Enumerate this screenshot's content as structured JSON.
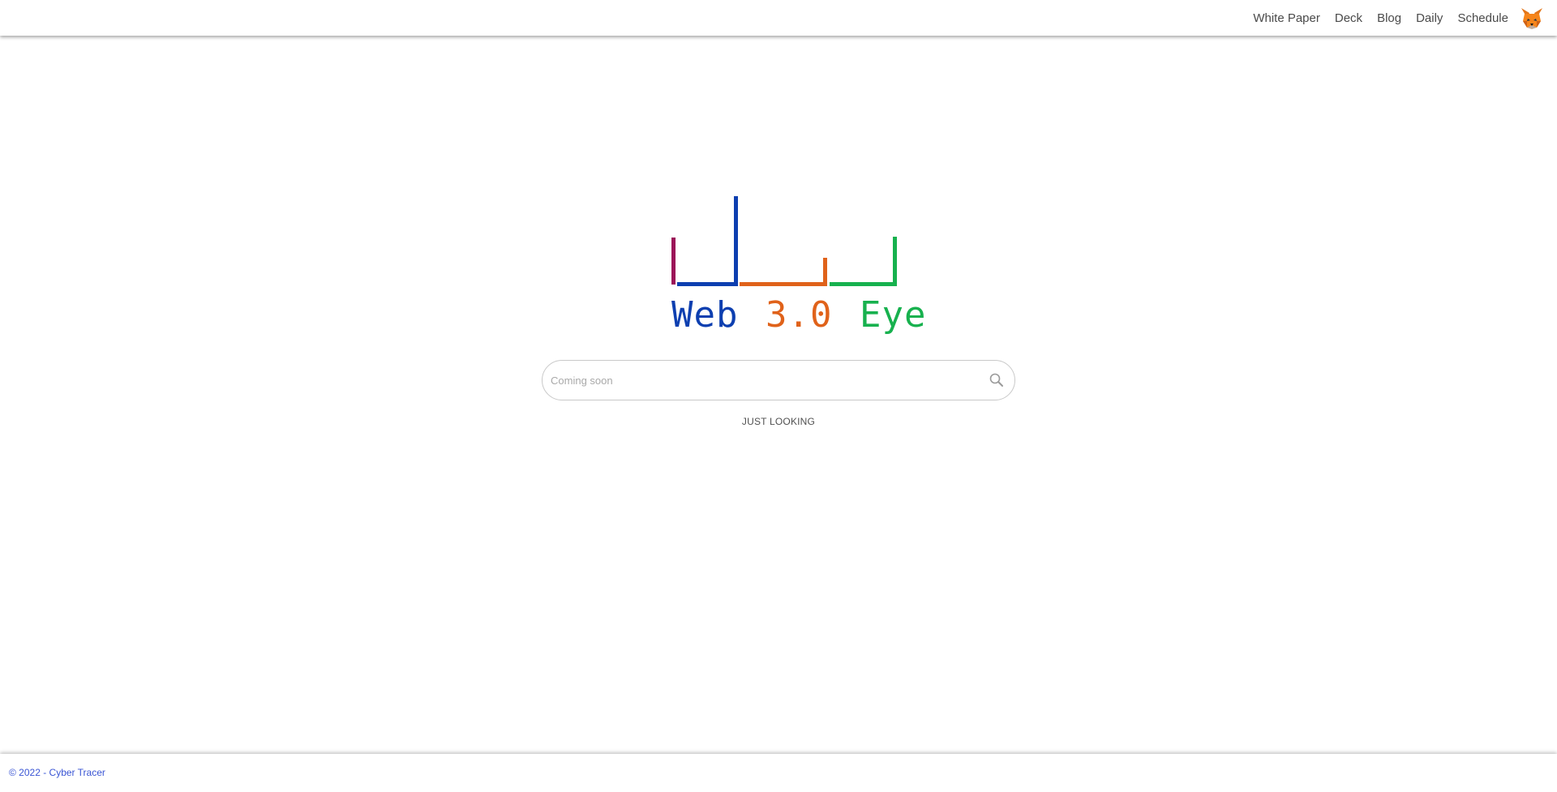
{
  "nav": {
    "items": [
      {
        "label": "White Paper"
      },
      {
        "label": "Deck"
      },
      {
        "label": "Blog"
      },
      {
        "label": "Daily"
      },
      {
        "label": "Schedule"
      }
    ],
    "wallet_icon": "metamask-fox-icon"
  },
  "logo": {
    "word1": "Web",
    "word2": "3.0",
    "word3": "Eye",
    "colors": {
      "purple": "#9b1458",
      "blue": "#0d3fb0",
      "orange": "#e0621a",
      "green": "#17b14e"
    }
  },
  "search": {
    "placeholder": "Coming soon",
    "value": "",
    "icon": "search-icon"
  },
  "actions": {
    "just_looking": "JUST LOOKING"
  },
  "footer": {
    "text": "© 2022 - Cyber Tracer",
    "color": "#3a55d4"
  }
}
